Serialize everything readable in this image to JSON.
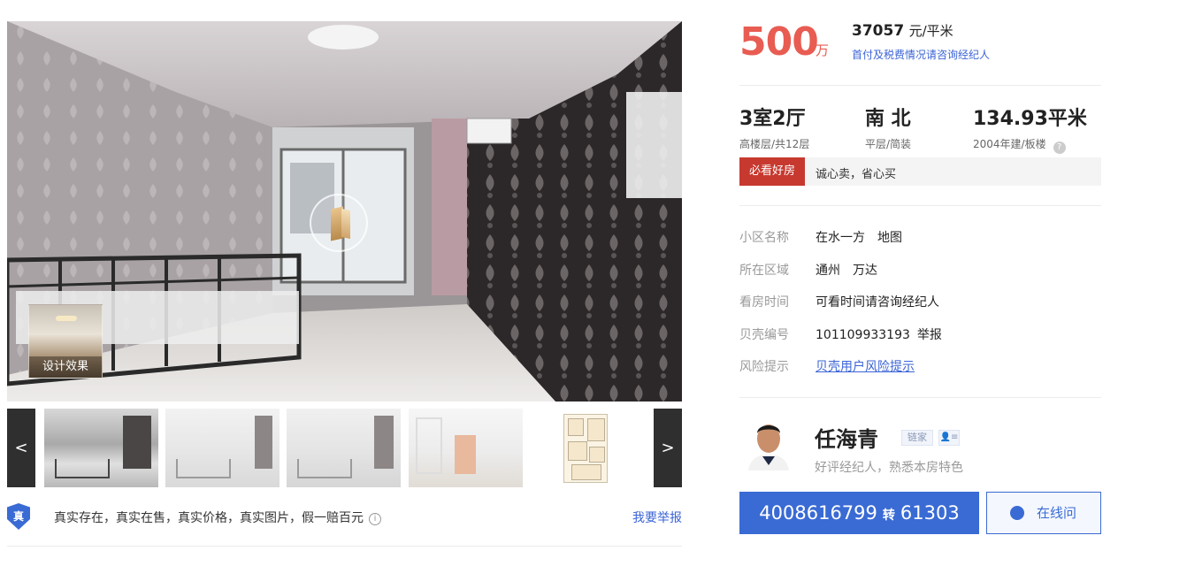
{
  "gallery": {
    "design_label": "设计效果",
    "prev_label": "<",
    "next_label": ">",
    "thumbnails": [
      "bedroom-photo-1",
      "living-room-photo",
      "living-room-photo-2",
      "empty-room-photo",
      "floor-plan"
    ]
  },
  "verification": {
    "shield_char": "真",
    "text": "真实存在，真实在售，真实价格，真实图片，假一赔百元",
    "info_icon": "i",
    "report_label": "我要举报"
  },
  "price": {
    "total": "500",
    "total_unit": "万",
    "unit_price_value": "37057",
    "unit_price_unit": "元/平米",
    "downpayment_note": "首付及税费情况请咨询经纪人"
  },
  "facts": {
    "layout": "3室2厅",
    "floor": "高楼层/共12层",
    "orientation": "南 北",
    "decoration": "平层/简装",
    "area": "134.93平米",
    "built": "2004年建/板楼",
    "help_icon": "?"
  },
  "highlight": {
    "badge": "必看好房",
    "text": "诚心卖，省心买"
  },
  "attributes": {
    "community_key": "小区名称",
    "community_value": "在水一方",
    "community_map": "地图",
    "district_key": "所在区域",
    "district_value": "通州",
    "district_sub": "万达",
    "visit_key": "看房时间",
    "visit_value": "可看时间请咨询经纪人",
    "id_key": "贝壳编号",
    "id_value": "101109933193",
    "id_report": "举报",
    "risk_key": "风险提示",
    "risk_value": "贝壳用户风险提示"
  },
  "agent": {
    "name": "任海青",
    "brand": "链家",
    "card_icon": "👤≡",
    "description": "好评经纪人，熟悉本房特色",
    "phone_main": "4008616799",
    "phone_transfer": "转",
    "phone_ext": "61303",
    "online_label": "在线问"
  },
  "colors": {
    "price_red": "#e85c52",
    "brand_blue": "#3a6bd4",
    "badge_red": "#c7392f"
  }
}
